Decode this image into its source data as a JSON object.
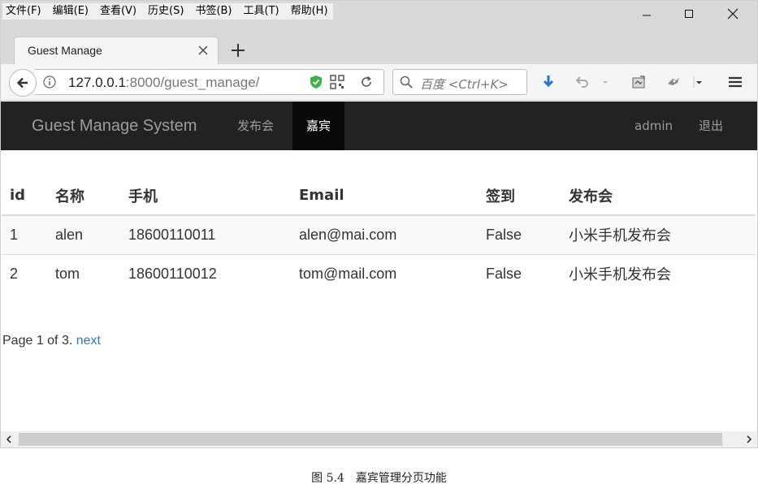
{
  "menu": [
    "文件(F)",
    "编辑(E)",
    "查看(V)",
    "历史(S)",
    "书签(B)",
    "工具(T)",
    "帮助(H)"
  ],
  "tab": {
    "title": "Guest Manage"
  },
  "url": {
    "host": "127.0.0.1",
    "rest": ":8000/guest_manage/"
  },
  "search": {
    "placeholder": "百度 <Ctrl+K>"
  },
  "site": {
    "brand": "Guest Manage System",
    "nav": [
      "发布会",
      "嘉宾"
    ],
    "active_nav": "嘉宾",
    "user": "admin",
    "logout": "退出"
  },
  "table": {
    "headers": [
      "id",
      "名称",
      "手机",
      "Email",
      "签到",
      "发布会"
    ],
    "rows": [
      [
        "1",
        "alen",
        "18600110011",
        "alen@mai.com",
        "False",
        "小米手机发布会"
      ],
      [
        "2",
        "tom",
        "18600110012",
        "tom@mail.com",
        "False",
        "小米手机发布会"
      ]
    ]
  },
  "pager": {
    "text": "Page 1 of 3.",
    "next": "next"
  },
  "caption": "图 5.4　嘉宾管理分页功能",
  "colors": {
    "navbar": "#222222",
    "active_nav": "#080808",
    "link": "#337ab7"
  }
}
